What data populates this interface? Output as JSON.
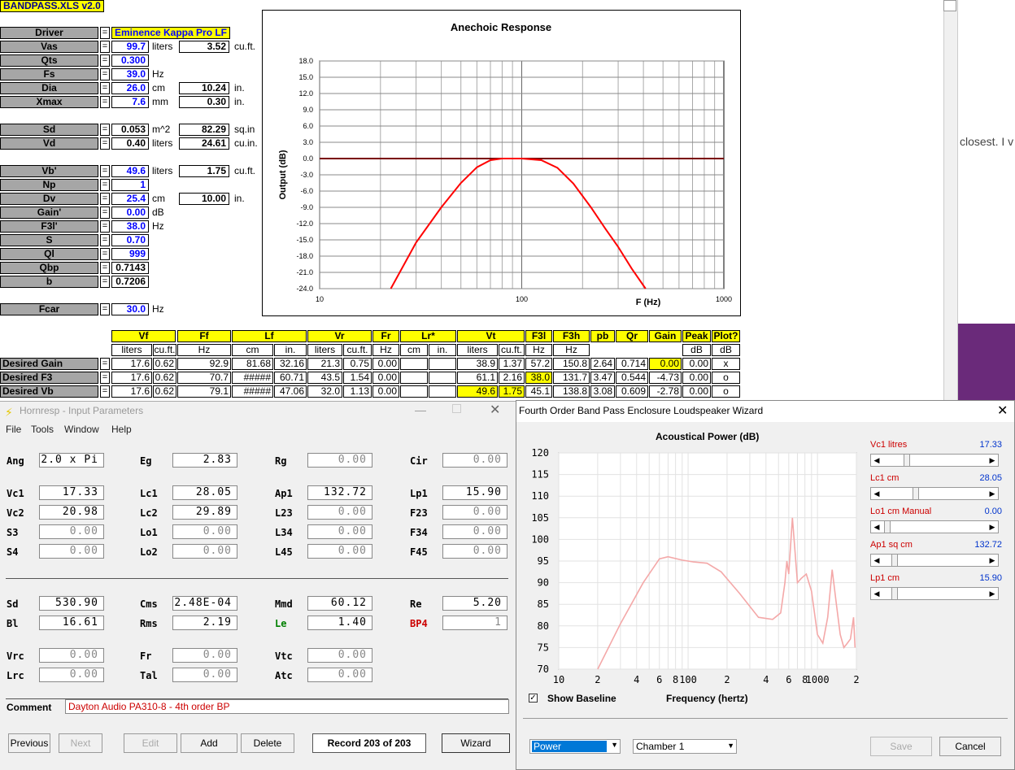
{
  "sheet": {
    "title": "BANDPASS.XLS v2.0",
    "driver_label": "Driver",
    "driver_value": "Eminence Kappa Pro LF",
    "params": [
      {
        "label": "Vas",
        "value": "99.7",
        "unit": "liters",
        "value2": "3.52",
        "unit2": "cu.ft."
      },
      {
        "label": "Qts",
        "value": "0.300",
        "unit": "",
        "value2": "",
        "unit2": ""
      },
      {
        "label": "Fs",
        "value": "39.0",
        "unit": "Hz",
        "value2": "",
        "unit2": ""
      },
      {
        "label": "Dia",
        "value": "26.0",
        "unit": "cm",
        "value2": "10.24",
        "unit2": "in."
      },
      {
        "label": "Xmax",
        "value": "7.6",
        "unit": "mm",
        "value2": "0.30",
        "unit2": "in."
      },
      {
        "label": "Sd",
        "value": "0.053",
        "unit": "m^2",
        "value2": "82.29",
        "unit2": "sq.in"
      },
      {
        "label": "Vd",
        "value": "0.40",
        "unit": "liters",
        "value2": "24.61",
        "unit2": "cu.in."
      },
      {
        "label": "Vb'",
        "value": "49.6",
        "unit": "liters",
        "value2": "1.75",
        "unit2": "cu.ft."
      },
      {
        "label": "Np",
        "value": "1",
        "unit": "",
        "value2": "",
        "unit2": ""
      },
      {
        "label": "Dv",
        "value": "25.4",
        "unit": "cm",
        "value2": "10.00",
        "unit2": "in."
      },
      {
        "label": "Gain'",
        "value": "0.00",
        "unit": "dB",
        "value2": "",
        "unit2": ""
      },
      {
        "label": "F3l'",
        "value": "38.0",
        "unit": "Hz",
        "value2": "",
        "unit2": ""
      },
      {
        "label": "S",
        "value": "0.70",
        "unit": "",
        "value2": "",
        "unit2": ""
      },
      {
        "label": "Ql",
        "value": "999",
        "unit": "",
        "value2": "",
        "unit2": ""
      },
      {
        "label": "Qbp",
        "value": "0.7143",
        "unit": "",
        "value2": "",
        "unit2": ""
      },
      {
        "label": "b",
        "value": "0.7206",
        "unit": "",
        "value2": "",
        "unit2": ""
      },
      {
        "label": "Fcar",
        "value": "30.0",
        "unit": "Hz",
        "value2": "",
        "unit2": ""
      }
    ],
    "eq_sign": "=",
    "table": {
      "headers": [
        "Vf",
        "Ff",
        "Lf",
        "Vr",
        "Fr",
        "Lr*",
        "Vt",
        "F3l",
        "F3h",
        "pb",
        "Qr",
        "Gain",
        "Peak",
        "Plot?"
      ],
      "units": [
        "liters",
        "cu.ft.",
        "Hz",
        "cm",
        "in.",
        "liters",
        "cu.ft.",
        "Hz",
        "cm",
        "in.",
        "liters",
        "cu.ft.",
        "Hz",
        "Hz",
        "dB",
        "dB"
      ],
      "rows": [
        {
          "label": "Desired Gain",
          "cells": [
            "17.6",
            "0.62",
            "92.9",
            "81.68",
            "32.16",
            "21.3",
            "0.75",
            "0.00",
            "",
            "",
            "38.9",
            "1.37",
            "57.2",
            "150.8",
            "2.64",
            "0.714",
            "0.00",
            "0.00",
            "x"
          ]
        },
        {
          "label": "Desired F3",
          "cells": [
            "17.6",
            "0.62",
            "70.7",
            "#####",
            "60.71",
            "43.5",
            "1.54",
            "0.00",
            "",
            "",
            "61.1",
            "2.16",
            "38.0",
            "131.7",
            "3.47",
            "0.544",
            "-4.73",
            "0.00",
            "o"
          ]
        },
        {
          "label": "Desired Vb",
          "cells": [
            "17.6",
            "0.62",
            "79.1",
            "#####",
            "47.06",
            "32.0",
            "1.13",
            "0.00",
            "",
            "",
            "49.6",
            "1.75",
            "45.1",
            "138.8",
            "3.08",
            "0.609",
            "-2.78",
            "0.00",
            "o"
          ]
        }
      ]
    }
  },
  "chart1": {
    "title": "Anechoic Response",
    "ylabel": "Output (dB)",
    "xlabel": "F (Hz)",
    "yticks": [
      "18.0",
      "15.0",
      "12.0",
      "9.0",
      "6.0",
      "3.0",
      "0.0",
      "-3.0",
      "-6.0",
      "-9.0",
      "-12.0",
      "-15.0",
      "-18.0",
      "-21.0",
      "-24.0"
    ],
    "xticks": [
      "10",
      "100",
      "1000"
    ],
    "color": "#ff0000"
  },
  "chart_data": [
    {
      "type": "line",
      "title": "Anechoic Response",
      "xlabel": "F (Hz)",
      "ylabel": "Output (dB)",
      "xscale": "log",
      "xlim": [
        10,
        1000
      ],
      "ylim": [
        -24,
        18
      ],
      "grid": true,
      "series": [
        {
          "x": [
            22.5,
            30,
            40,
            50,
            60,
            70,
            80,
            100,
            125,
            150,
            180,
            220,
            260,
            300,
            350,
            410
          ],
          "y": [
            -24,
            -15.5,
            -9,
            -4.5,
            -1.6,
            -0.3,
            0,
            0,
            -0.3,
            -1.7,
            -4.6,
            -9,
            -13,
            -16.3,
            -20.3,
            -24
          ]
        }
      ]
    },
    {
      "type": "line",
      "title": "Acoustical Power (dB)",
      "xlabel": "Frequency (hertz)",
      "xscale": "log",
      "xlim": [
        10,
        2000
      ],
      "ylim": [
        70,
        120
      ],
      "grid": true,
      "series": [
        {
          "x": [
            20,
            30,
            45,
            60,
            70,
            90,
            110,
            140,
            180,
            250,
            350,
            450,
            520,
            560,
            580,
            600,
            640,
            700,
            750,
            820,
            900,
            1000,
            1100,
            1200,
            1300,
            1400,
            1500,
            1600,
            1700,
            1800,
            1900,
            1950
          ],
          "y": [
            70,
            80.5,
            90,
            95.5,
            96,
            95.2,
            94.8,
            94.5,
            92.5,
            87.5,
            82,
            81.5,
            83,
            90,
            95,
            92,
            105,
            90,
            91,
            92,
            88,
            78,
            76,
            82,
            93,
            85,
            78,
            75,
            76,
            77,
            82,
            75
          ]
        }
      ]
    }
  ],
  "hornresp": {
    "title": "Hornresp - Input Parameters",
    "menu": [
      "File",
      "Tools",
      "Window",
      "Help"
    ],
    "fields": [
      {
        "label": "Ang",
        "value": "2.0 x Pi",
        "color": "#000000"
      },
      {
        "label": "Eg",
        "value": "2.83",
        "color": "#000000"
      },
      {
        "label": "Rg",
        "value": "0.00",
        "color": "#000000"
      },
      {
        "label": "Cir",
        "value": "0.00",
        "color": "#000000"
      },
      {
        "label": "Vc1",
        "value": "17.33",
        "color": "#000000"
      },
      {
        "label": "Lc1",
        "value": "28.05",
        "color": "#000000"
      },
      {
        "label": "Ap1",
        "value": "132.72",
        "color": "#000000"
      },
      {
        "label": "Lp1",
        "value": "15.90",
        "color": "#000000"
      },
      {
        "label": "Vc2",
        "value": "20.98",
        "color": "#000000"
      },
      {
        "label": "Lc2",
        "value": "29.89",
        "color": "#000000"
      },
      {
        "label": "L23",
        "value": "0.00",
        "color": "#000000"
      },
      {
        "label": "F23",
        "value": "0.00",
        "color": "#000000"
      },
      {
        "label": "S3",
        "value": "0.00",
        "color": "#000000"
      },
      {
        "label": "Lo1",
        "value": "0.00",
        "color": "#000000"
      },
      {
        "label": "L34",
        "value": "0.00",
        "color": "#000000"
      },
      {
        "label": "F34",
        "value": "0.00",
        "color": "#000000"
      },
      {
        "label": "S4",
        "value": "0.00",
        "color": "#000000"
      },
      {
        "label": "Lo2",
        "value": "0.00",
        "color": "#000000"
      },
      {
        "label": "L45",
        "value": "0.00",
        "color": "#000000"
      },
      {
        "label": "F45",
        "value": "0.00",
        "color": "#000000"
      },
      {
        "label": "Sd",
        "value": "530.90",
        "color": "#000000"
      },
      {
        "label": "Cms",
        "value": "2.48E-04",
        "color": "#000000"
      },
      {
        "label": "Mmd",
        "value": "60.12",
        "color": "#000000"
      },
      {
        "label": "Re",
        "value": "5.20",
        "color": "#000000"
      },
      {
        "label": "Bl",
        "value": "16.61",
        "color": "#000000"
      },
      {
        "label": "Rms",
        "value": "2.19",
        "color": "#000000"
      },
      {
        "label": "Le",
        "value": "1.40",
        "color": "#008000"
      },
      {
        "label": "BP4",
        "value": "1",
        "color": "#cc0000"
      },
      {
        "label": "Vrc",
        "value": "0.00",
        "color": "#000000"
      },
      {
        "label": "Fr",
        "value": "0.00",
        "color": "#000000"
      },
      {
        "label": "Vtc",
        "value": "0.00",
        "color": "#000000"
      },
      {
        "label": "Lrc",
        "value": "0.00",
        "color": "#000000"
      },
      {
        "label": "Tal",
        "value": "0.00",
        "color": "#000000"
      },
      {
        "label": "Atc",
        "value": "0.00",
        "color": "#000000"
      }
    ],
    "comment_label": "Comment",
    "comment_value": "Dayton Audio PA310-8 - 4th order BP",
    "buttons": {
      "previous": "Previous",
      "next": "Next",
      "edit": "Edit",
      "add": "Add",
      "delete": "Delete",
      "wizard": "Wizard"
    },
    "record": "Record 203 of 203"
  },
  "wizard": {
    "title": "Fourth Order Band Pass Enclosure Loudspeaker Wizard",
    "chart_title": "Acoustical Power (dB)",
    "yticks": [
      "120",
      "115",
      "110",
      "105",
      "100",
      "95",
      "90",
      "85",
      "80",
      "75",
      "70"
    ],
    "xticks": [
      "10",
      "2",
      "4",
      "6",
      "8",
      "100",
      "2",
      "4",
      "6",
      "8",
      "1000",
      "2"
    ],
    "xlabel": "Frequency (hertz)",
    "baseline_label": "Show Baseline",
    "curve_color": "#f4a8a8",
    "sliders": [
      {
        "label": "Vc1  litres",
        "value": "17.33",
        "pos": 0.2
      },
      {
        "label": "Lc1  cm",
        "value": "28.05",
        "pos": 0.3
      },
      {
        "label": "Lo1  cm  Manual",
        "value": "0.00",
        "pos": 0.0
      },
      {
        "label": "Ap1  sq cm",
        "value": "132.72",
        "pos": 0.08
      },
      {
        "label": "Lp1  cm",
        "value": "15.90",
        "pos": 0.08
      }
    ],
    "mode_select": "Power",
    "chamber_select": "Chamber 1",
    "save": "Save",
    "cancel": "Cancel"
  },
  "bg_text": "closest. I v"
}
